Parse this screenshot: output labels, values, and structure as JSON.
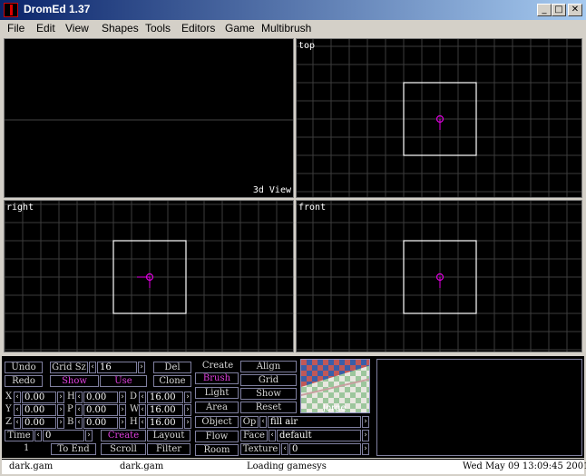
{
  "window": {
    "title": "DromEd  1.37",
    "minimize": "_",
    "maximize": "□",
    "close": "✕"
  },
  "menu": [
    "File",
    "Edit",
    "View",
    "Shapes",
    "Tools",
    "Editors",
    "Game",
    "Multibrush"
  ],
  "viewports": {
    "view3d": "3d View",
    "top": "top",
    "right": "right",
    "front": "front"
  },
  "controls": {
    "undo": "Undo",
    "redo": "Redo",
    "gridsz_label": "Grid Sz",
    "gridsz_value": "16",
    "show": "Show",
    "use": "Use",
    "del": "Del",
    "clone": "Clone",
    "coords": [
      {
        "label": "X",
        "value": "0.00",
        "rot_label": "H",
        "rot_value": "0.00",
        "dim_label": "D",
        "dim_value": "16.00"
      },
      {
        "label": "Y",
        "value": "0.00",
        "rot_label": "P",
        "rot_value": "0.00",
        "dim_label": "W",
        "dim_value": "16.00"
      },
      {
        "label": "Z",
        "value": "0.00",
        "rot_label": "B",
        "rot_value": "0.00",
        "dim_label": "H",
        "dim_value": "16.00"
      }
    ],
    "time_label": "Time",
    "time_value": "0",
    "frame_value": "1",
    "create_pink": "Create",
    "layout": "Layout",
    "to_end": "To End",
    "scroll": "Scroll",
    "filter": "Filter",
    "create_header": "Create",
    "brush": "Brush",
    "light": "Light",
    "area": "Area",
    "object": "Object",
    "flow": "Flow",
    "room": "Room",
    "align": "Align",
    "grid": "Grid",
    "show2": "Show",
    "reset": "Reset",
    "texture_name": "Jorge",
    "op_label": "Op",
    "op_value": "fill air",
    "face_label": "Face",
    "face_value": "default",
    "texture_label": "Texture",
    "texture_value": "0"
  },
  "status": {
    "left": "dark.gam",
    "mid": "dark.gam",
    "message": "Loading gamesys",
    "datetime": "Wed May 09 13:09:45 2001"
  },
  "colors": {
    "grid": "#3c3c3c",
    "brush_outline": "#ffffff",
    "origin": "#e000e0",
    "highlight_text": "#e040e0"
  }
}
